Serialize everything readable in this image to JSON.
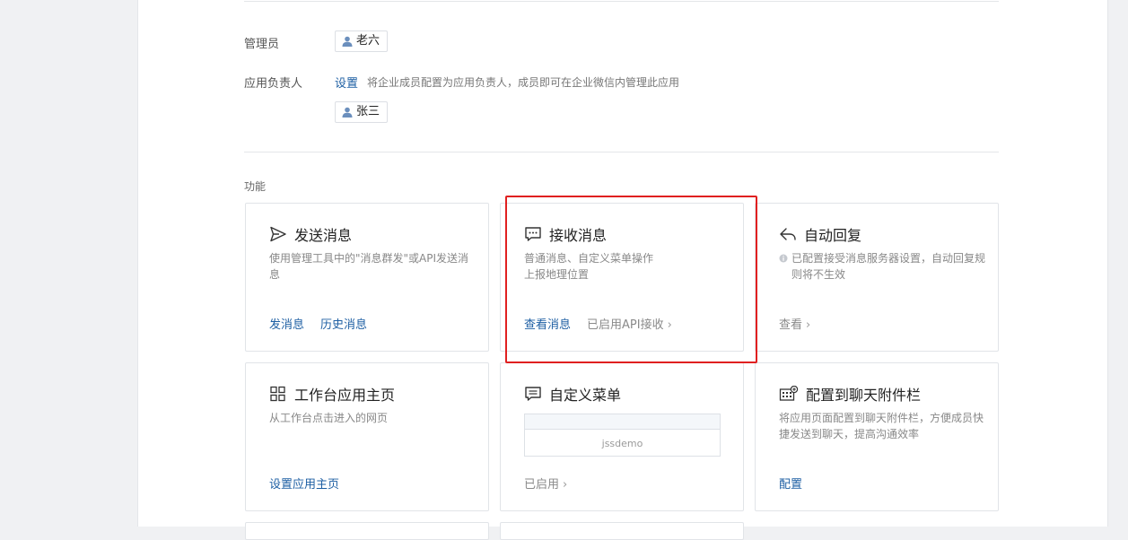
{
  "settings": {
    "admin_label": "管理员",
    "admin_name": "老六",
    "owner_label": "应用负责人",
    "owner_set_link": "设置",
    "owner_hint": "将企业成员配置为应用负责人，成员即可在企业微信内管理此应用",
    "owner_name": "张三"
  },
  "features": {
    "section_label": "功能",
    "cards": [
      {
        "title": "发送消息",
        "icon": "send-icon",
        "desc": "使用管理工具中的\"消息群发\"或API发送消息",
        "actions": [
          "发消息",
          "历史消息"
        ]
      },
      {
        "title": "接收消息",
        "icon": "chat-bubble-icon",
        "desc_line1": "普通消息、自定义菜单操作",
        "desc_line2": "上报地理位置",
        "actions": [
          "查看消息"
        ],
        "status": "已启用API接收"
      },
      {
        "title": "自动回复",
        "icon": "reply-icon",
        "desc": "已配置接受消息服务器设置，自动回复规则将不生效",
        "actions": [
          "查看"
        ]
      },
      {
        "title": "工作台应用主页",
        "icon": "grid-icon",
        "desc": "从工作台点击进入的网页",
        "actions": [
          "设置应用主页"
        ]
      },
      {
        "title": "自定义菜单",
        "icon": "menu-icon",
        "preview_text": "jssdemo",
        "status": "已启用"
      },
      {
        "title": "配置到聊天附件栏",
        "icon": "attachment-bar-icon",
        "desc": "将应用页面配置到聊天附件栏，方便成员快捷发送到聊天，提高沟通效率",
        "actions": [
          "配置"
        ]
      }
    ]
  },
  "colors": {
    "link": "#1e5fa3",
    "highlight": "#e02020"
  }
}
